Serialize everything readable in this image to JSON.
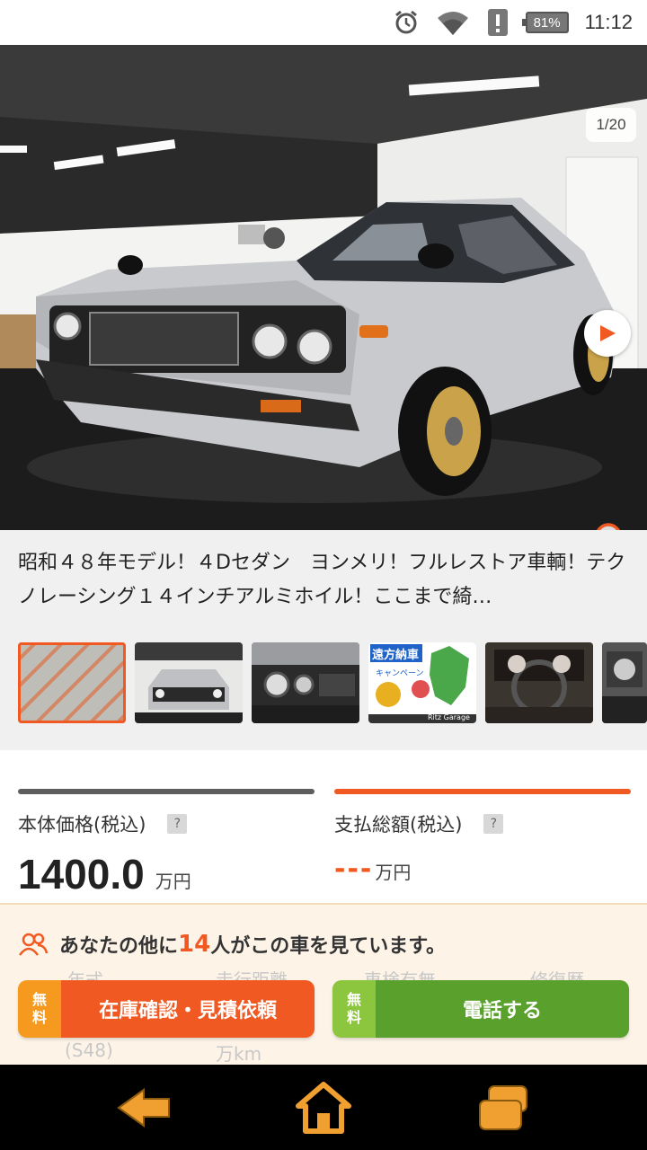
{
  "status_bar": {
    "battery": "81%",
    "time": "11:12"
  },
  "gallery": {
    "counter": "1/20"
  },
  "listing": {
    "title": "昭和４８年モデル！４Dセダン　ヨンメリ！フルレストア車輌！テクノレーシング１４インチアルミホイル！ここまで綺…"
  },
  "thumbnails": {
    "ad_title": "遠方納車",
    "ad_sub": "キャンペーン",
    "ad_brand": "Ritz Garage"
  },
  "price": {
    "body_label": "本体価格(税込)",
    "body_value": "1400.0",
    "body_unit": "万円",
    "total_label": "支払総額(税込)",
    "total_value": "---",
    "total_unit": "万円",
    "help_icon": "?"
  },
  "spec_ghost": {
    "year_label": "年式",
    "year_value": "(S48)",
    "mileage_label": "走行距離",
    "mileage_unit": "万km",
    "inspection_label": "車検有無",
    "repair_label": "修復歴"
  },
  "viewers": {
    "prefix": "あなたの他に",
    "count": "14",
    "suffix": "人がこの車を見ています。"
  },
  "cta": {
    "free_badge_top": "無",
    "free_badge_bottom": "料",
    "inquiry_label": "在庫確認・見積依頼",
    "call_label": "電話する"
  },
  "colors": {
    "accent": "#f05a22",
    "green": "#5aa02c",
    "panel": "#fdf3e7",
    "nav_icon": "#f0a030"
  }
}
